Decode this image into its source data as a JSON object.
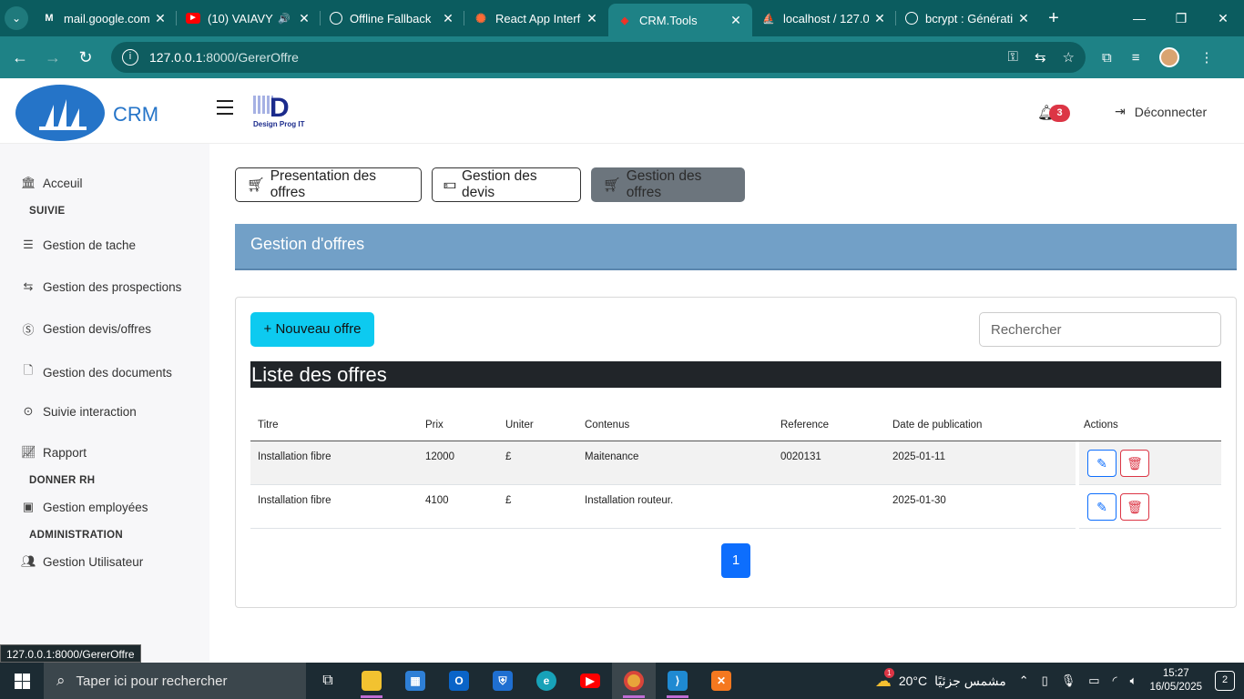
{
  "browser": {
    "tabs": [
      {
        "title": "mail.google.com",
        "icon": "gmail-icon",
        "color": "#ffffff"
      },
      {
        "title": "(10) VAIAVY",
        "icon": "youtube-icon",
        "color": "#ff0000"
      },
      {
        "title": "Offline Fallback",
        "icon": "globe-icon",
        "color": "#ffffff"
      },
      {
        "title": "React App Interf",
        "icon": "react-icon",
        "color": "#ff6b35"
      },
      {
        "title": "CRM.Tools",
        "icon": "laravel-icon",
        "color": "#ff2d20"
      },
      {
        "title": "localhost / 127.0",
        "icon": "phpmyadmin-icon",
        "color": "#f0a020"
      },
      {
        "title": "bcrypt : Générati",
        "icon": "globe-icon",
        "color": "#ffffff"
      }
    ],
    "url_host": "127.0.0.1",
    "url_path": ":8000/GererOffre",
    "status_url": "127.0.0.1:8000/GererOffre"
  },
  "header": {
    "brand": "CRM",
    "partner_logo_text": "Design Prog IT",
    "partner_logo_letter": "D",
    "notification_count": "3",
    "logout_label": "Déconnecter"
  },
  "sidebar": {
    "items": [
      {
        "label": "Acceuil",
        "icon": "bank-icon"
      },
      {
        "label": "Gestion de tache",
        "icon": "list-icon"
      },
      {
        "label": "Gestion des prospections",
        "icon": "arrows-icon"
      },
      {
        "label": "Gestion devis/offres",
        "icon": "coin-icon"
      },
      {
        "label": "Gestion des documents",
        "icon": "document-icon"
      },
      {
        "label": "Suivie interaction",
        "icon": "target-icon"
      },
      {
        "label": "Rapport",
        "icon": "chart-icon"
      },
      {
        "label": "Gestion employées",
        "icon": "badge-icon"
      },
      {
        "label": "Gestion Utilisateur",
        "icon": "users-icon"
      }
    ],
    "sections": [
      "SUIVIE",
      "DONNER RH",
      "ADMINISTRATION"
    ]
  },
  "main": {
    "top_buttons": [
      {
        "label": "Presentation des offres",
        "icon": "cart-icon"
      },
      {
        "label": "Gestion des devis",
        "icon": "money-icon"
      },
      {
        "label": "Gestion des offres",
        "icon": "cart-icon"
      }
    ],
    "panel_title": "Gestion d'offres",
    "new_button": "+ Nouveau offre",
    "search_placeholder": "Rechercher",
    "list_title": "Liste des offres",
    "columns": [
      "Titre",
      "Prix",
      "Uniter",
      "Contenus",
      "Reference",
      "Date de publication",
      "Actions"
    ],
    "rows": [
      {
        "titre": "Installation fibre",
        "prix": "12000",
        "uniter": "£",
        "contenus": "Maitenance",
        "reference": "0020131",
        "date": "2025-01-11"
      },
      {
        "titre": "Installation fibre",
        "prix": "4100",
        "uniter": "£",
        "contenus": "Installation routeur.",
        "reference": "",
        "date": "2025-01-30"
      }
    ],
    "page": "1"
  },
  "taskbar": {
    "search_placeholder": "Taper ici pour rechercher",
    "temperature": "20°C",
    "weather_text": "مشمس جزئيًا",
    "weather_badge": "1",
    "time": "15:27",
    "date": "16/05/2025",
    "notifications": "2"
  }
}
